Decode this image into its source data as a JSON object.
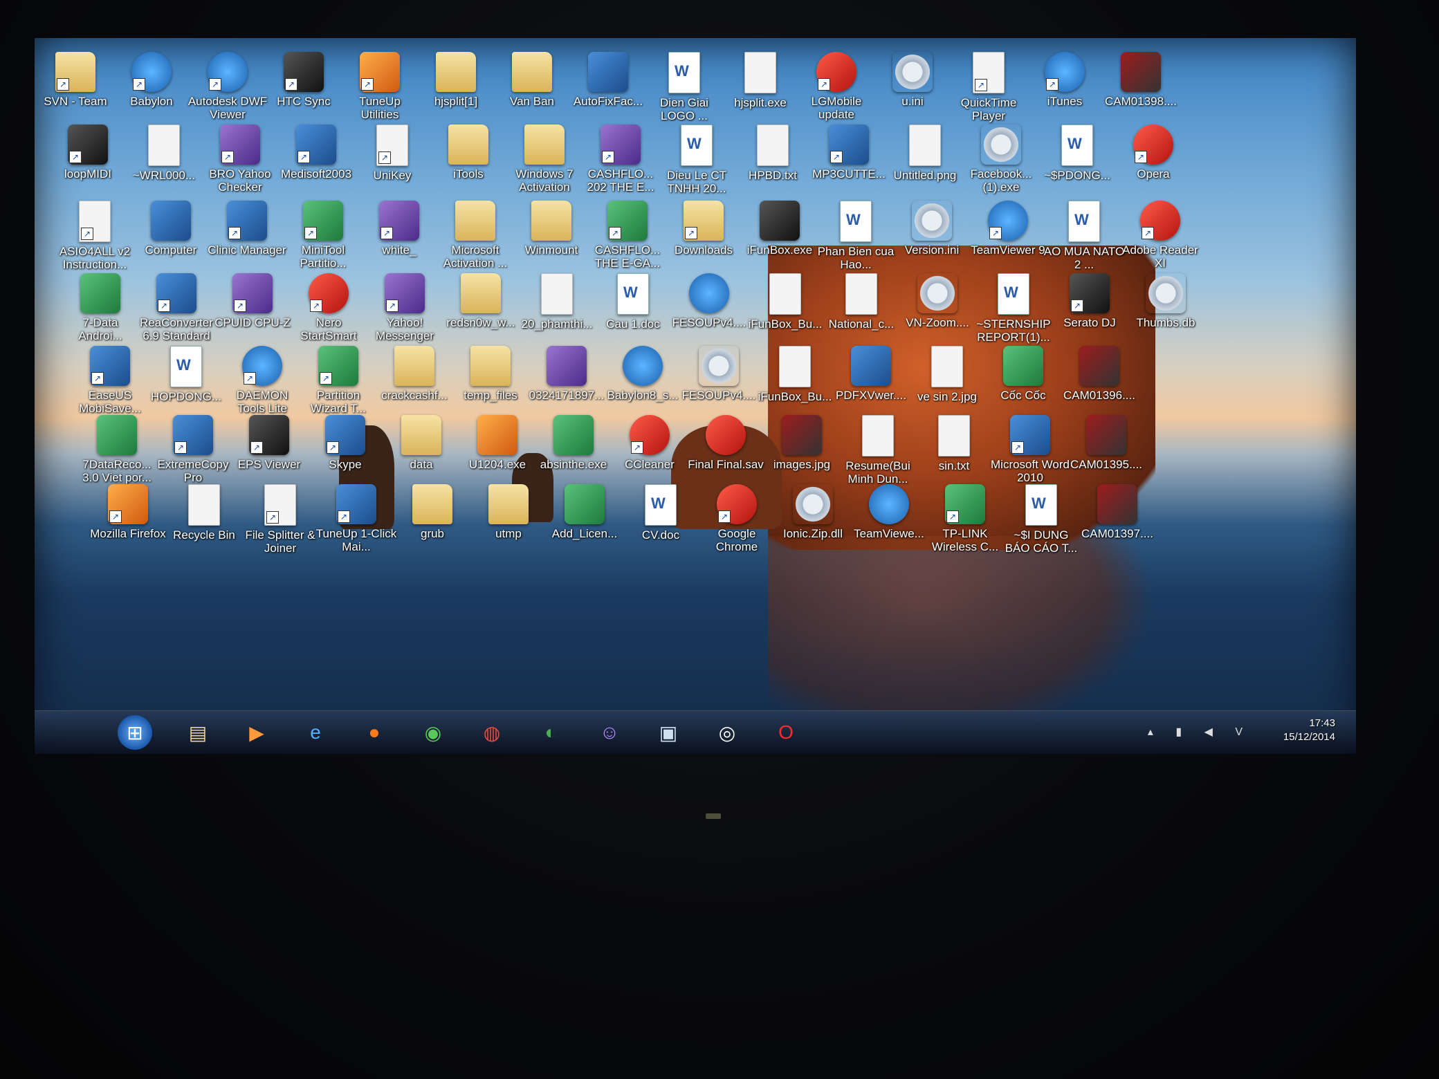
{
  "desktop": {
    "icons": [
      {
        "label": "SVN - Team",
        "glyph": "g-folder",
        "sc": true
      },
      {
        "label": "Babylon",
        "glyph": "g-blue-round",
        "sc": true
      },
      {
        "label": "Autodesk DWF Viewer",
        "glyph": "g-blue-round",
        "sc": true
      },
      {
        "label": "HTC Sync",
        "glyph": "g-dark",
        "sc": true
      },
      {
        "label": "TuneUp Utilities",
        "glyph": "g-orange",
        "sc": true
      },
      {
        "label": "hjsplit[1]",
        "glyph": "g-folder",
        "sc": false
      },
      {
        "label": "Van Ban",
        "glyph": "g-folder",
        "sc": false
      },
      {
        "label": "AutoFixFac...",
        "glyph": "g-app",
        "sc": false
      },
      {
        "label": "Dien Giai LOGO ...",
        "glyph": "g-word",
        "sc": false
      },
      {
        "label": "hjsplit.exe",
        "glyph": "g-doc",
        "sc": false
      },
      {
        "label": "LGMobile update",
        "glyph": "g-red",
        "sc": true
      },
      {
        "label": "u.ini",
        "glyph": "g-gear",
        "sc": false
      },
      {
        "label": "QuickTime Player",
        "glyph": "g-doc",
        "sc": true
      },
      {
        "label": "iTunes",
        "glyph": "g-blue-round",
        "sc": true
      },
      {
        "label": "CAM01398....",
        "glyph": "g-img",
        "sc": false
      },
      {
        "label": "loopMIDI",
        "glyph": "g-dark",
        "sc": true
      },
      {
        "label": "~WRL000...",
        "glyph": "g-doc",
        "sc": false
      },
      {
        "label": "BRO Yahoo Checker",
        "glyph": "g-purple",
        "sc": true
      },
      {
        "label": "Medisoft2003",
        "glyph": "g-app",
        "sc": true
      },
      {
        "label": "UniKey",
        "glyph": "g-doc",
        "sc": true
      },
      {
        "label": "iTools",
        "glyph": "g-folder",
        "sc": false
      },
      {
        "label": "Windows 7 Activation",
        "glyph": "g-folder",
        "sc": false
      },
      {
        "label": "CASHFLO... 202 THE E...",
        "glyph": "g-purple",
        "sc": true
      },
      {
        "label": "Dieu Le CT TNHH 20...",
        "glyph": "g-word",
        "sc": false
      },
      {
        "label": "HPBD.txt",
        "glyph": "g-doc",
        "sc": false
      },
      {
        "label": "MP3CUTTE...",
        "glyph": "g-app",
        "sc": true
      },
      {
        "label": "Untitled.png",
        "glyph": "g-doc",
        "sc": false
      },
      {
        "label": "Facebook... (1).exe",
        "glyph": "g-gear",
        "sc": false
      },
      {
        "label": "~$PDONG...",
        "glyph": "g-word",
        "sc": false
      },
      {
        "label": "Opera",
        "glyph": "g-red",
        "sc": true
      },
      {
        "label": "ASIO4ALL v2 Instruction...",
        "glyph": "g-doc",
        "sc": true
      },
      {
        "label": "Computer",
        "glyph": "g-app",
        "sc": false
      },
      {
        "label": "Clinic Manager",
        "glyph": "g-app",
        "sc": true
      },
      {
        "label": "MiniTool Partitio...",
        "glyph": "g-green",
        "sc": true
      },
      {
        "label": "white_",
        "glyph": "g-purple",
        "sc": true
      },
      {
        "label": "Microsoft Activation ...",
        "glyph": "g-folder",
        "sc": false
      },
      {
        "label": "Winmount",
        "glyph": "g-folder",
        "sc": false
      },
      {
        "label": "CASHFLO... THE E-GA...",
        "glyph": "g-green",
        "sc": true
      },
      {
        "label": "Downloads",
        "glyph": "g-folder",
        "sc": true
      },
      {
        "label": "iFunBox.exe",
        "glyph": "g-dark",
        "sc": false
      },
      {
        "label": "Phan Bien cua Hao...",
        "glyph": "g-word",
        "sc": false
      },
      {
        "label": "Version.ini",
        "glyph": "g-gear",
        "sc": false
      },
      {
        "label": "TeamViewer 9",
        "glyph": "g-blue-round",
        "sc": true
      },
      {
        "label": "AO MUA NATO 2 ...",
        "glyph": "g-word",
        "sc": false
      },
      {
        "label": "Adobe Reader XI",
        "glyph": "g-red",
        "sc": true
      },
      {
        "label": "7-Data Androi...",
        "glyph": "g-green",
        "sc": false
      },
      {
        "label": "ReaConverter 6.9 Standard",
        "glyph": "g-app",
        "sc": true
      },
      {
        "label": "CPUID CPU-Z",
        "glyph": "g-purple",
        "sc": true
      },
      {
        "label": "Nero StartSmart",
        "glyph": "g-red",
        "sc": true
      },
      {
        "label": "Yahoo! Messenger",
        "glyph": "g-purple",
        "sc": true
      },
      {
        "label": "redsn0w_w...",
        "glyph": "g-folder",
        "sc": false
      },
      {
        "label": "20_phamthi...",
        "glyph": "g-doc",
        "sc": false
      },
      {
        "label": "Cau 1.doc",
        "glyph": "g-word",
        "sc": false
      },
      {
        "label": "FESOUPv4....",
        "glyph": "g-blue-round",
        "sc": false
      },
      {
        "label": "iFunBox_Bu...",
        "glyph": "g-doc",
        "sc": false
      },
      {
        "label": "National_c...",
        "glyph": "g-doc",
        "sc": false
      },
      {
        "label": "VN-Zoom....",
        "glyph": "g-gear",
        "sc": false
      },
      {
        "label": "~STERNSHIP REPORT(1)...",
        "glyph": "g-word",
        "sc": false
      },
      {
        "label": "Serato DJ",
        "glyph": "g-dark",
        "sc": true
      },
      {
        "label": "Thumbs.db",
        "glyph": "g-gear",
        "sc": false
      },
      {
        "label": "EaseUS MobiSave...",
        "glyph": "g-app",
        "sc": true
      },
      {
        "label": "HOPDONG...",
        "glyph": "g-word",
        "sc": false
      },
      {
        "label": "DAEMON Tools Lite",
        "glyph": "g-blue-round",
        "sc": true
      },
      {
        "label": "Partition Wizard T...",
        "glyph": "g-green",
        "sc": true
      },
      {
        "label": "crackcashf...",
        "glyph": "g-folder",
        "sc": false
      },
      {
        "label": "temp_files",
        "glyph": "g-folder",
        "sc": false
      },
      {
        "label": "0324171897...",
        "glyph": "g-purple",
        "sc": false
      },
      {
        "label": "Babylon8_s...",
        "glyph": "g-blue-round",
        "sc": false
      },
      {
        "label": "FESOUPv4....",
        "glyph": "g-gear",
        "sc": false
      },
      {
        "label": "iFunBox_Bu...",
        "glyph": "g-doc",
        "sc": false
      },
      {
        "label": "PDFXVwer....",
        "glyph": "g-app",
        "sc": false
      },
      {
        "label": "ve sin 2.jpg",
        "glyph": "g-doc",
        "sc": false
      },
      {
        "label": "Cốc Cốc",
        "glyph": "g-green",
        "sc": false
      },
      {
        "label": "CAM01396....",
        "glyph": "g-img",
        "sc": false
      },
      {
        "label": "7DataReco... 3.0 Viet por...",
        "glyph": "g-green",
        "sc": false
      },
      {
        "label": "ExtremeCopy Pro",
        "glyph": "g-app",
        "sc": true
      },
      {
        "label": "EPS Viewer",
        "glyph": "g-dark",
        "sc": true
      },
      {
        "label": "Skype",
        "glyph": "g-app",
        "sc": true
      },
      {
        "label": "data",
        "glyph": "g-folder",
        "sc": false
      },
      {
        "label": "U1204.exe",
        "glyph": "g-orange",
        "sc": false
      },
      {
        "label": "absinthe.exe",
        "glyph": "g-green",
        "sc": false
      },
      {
        "label": "CCleaner",
        "glyph": "g-red",
        "sc": true
      },
      {
        "label": "Final Final.sav",
        "glyph": "g-red",
        "sc": false
      },
      {
        "label": "images.jpg",
        "glyph": "g-img",
        "sc": false
      },
      {
        "label": "Resume(Bui Minh Dun...",
        "glyph": "g-doc",
        "sc": false
      },
      {
        "label": "sin.txt",
        "glyph": "g-doc",
        "sc": false
      },
      {
        "label": "Microsoft Word 2010",
        "glyph": "g-app",
        "sc": true
      },
      {
        "label": "CAM01395....",
        "glyph": "g-img",
        "sc": false
      },
      {
        "label": "Mozilla Firefox",
        "glyph": "g-orange",
        "sc": true
      },
      {
        "label": "Recycle Bin",
        "glyph": "g-doc",
        "sc": false
      },
      {
        "label": "File Splitter & Joiner",
        "glyph": "g-doc",
        "sc": true
      },
      {
        "label": "TuneUp 1-Click Mai...",
        "glyph": "g-app",
        "sc": true
      },
      {
        "label": "grub",
        "glyph": "g-folder",
        "sc": false
      },
      {
        "label": "utmp",
        "glyph": "g-folder",
        "sc": false
      },
      {
        "label": "Add_Licen...",
        "glyph": "g-green",
        "sc": false
      },
      {
        "label": "CV.doc",
        "glyph": "g-word",
        "sc": false
      },
      {
        "label": "Google Chrome",
        "glyph": "g-red",
        "sc": true
      },
      {
        "label": "Ionic.Zip.dll",
        "glyph": "g-gear",
        "sc": false
      },
      {
        "label": "TeamViewe...",
        "glyph": "g-blue-round",
        "sc": false
      },
      {
        "label": "TP-LINK Wireless C...",
        "glyph": "g-green",
        "sc": true
      },
      {
        "label": "~$I DUNG BÁO CÁO T...",
        "glyph": "g-word",
        "sc": false
      },
      {
        "label": "CAM01397....",
        "glyph": "g-img",
        "sc": false
      }
    ]
  },
  "taskbar": {
    "pinned": [
      {
        "name": "start-button",
        "glyph": "⊞",
        "color": "#ffffff"
      },
      {
        "name": "explorer-icon",
        "glyph": "▤",
        "color": "#f2d38a"
      },
      {
        "name": "media-player-icon",
        "glyph": "▶",
        "color": "#ff9a3c"
      },
      {
        "name": "internet-explorer-icon",
        "glyph": "e",
        "color": "#4fb3ff"
      },
      {
        "name": "firefox-icon",
        "glyph": "●",
        "color": "#ff7a1a"
      },
      {
        "name": "coccoc-icon",
        "glyph": "◉",
        "color": "#5ac85a"
      },
      {
        "name": "chrome-icon",
        "glyph": "◍",
        "color": "#e74c3c"
      },
      {
        "name": "babylon-icon",
        "glyph": "◐",
        "color": "#4ab04a"
      },
      {
        "name": "yahoo-messenger-icon",
        "glyph": "☺",
        "color": "#b58cff"
      },
      {
        "name": "window-icon",
        "glyph": "▣",
        "color": "#d0e0f0"
      },
      {
        "name": "serato-icon",
        "glyph": "◎",
        "color": "#ffffff"
      },
      {
        "name": "opera-icon",
        "glyph": "O",
        "color": "#ff2a2a"
      }
    ],
    "tray": {
      "time": "17:43",
      "date": "15/12/2014",
      "icons": "▴ ▮ ◀ V"
    }
  }
}
